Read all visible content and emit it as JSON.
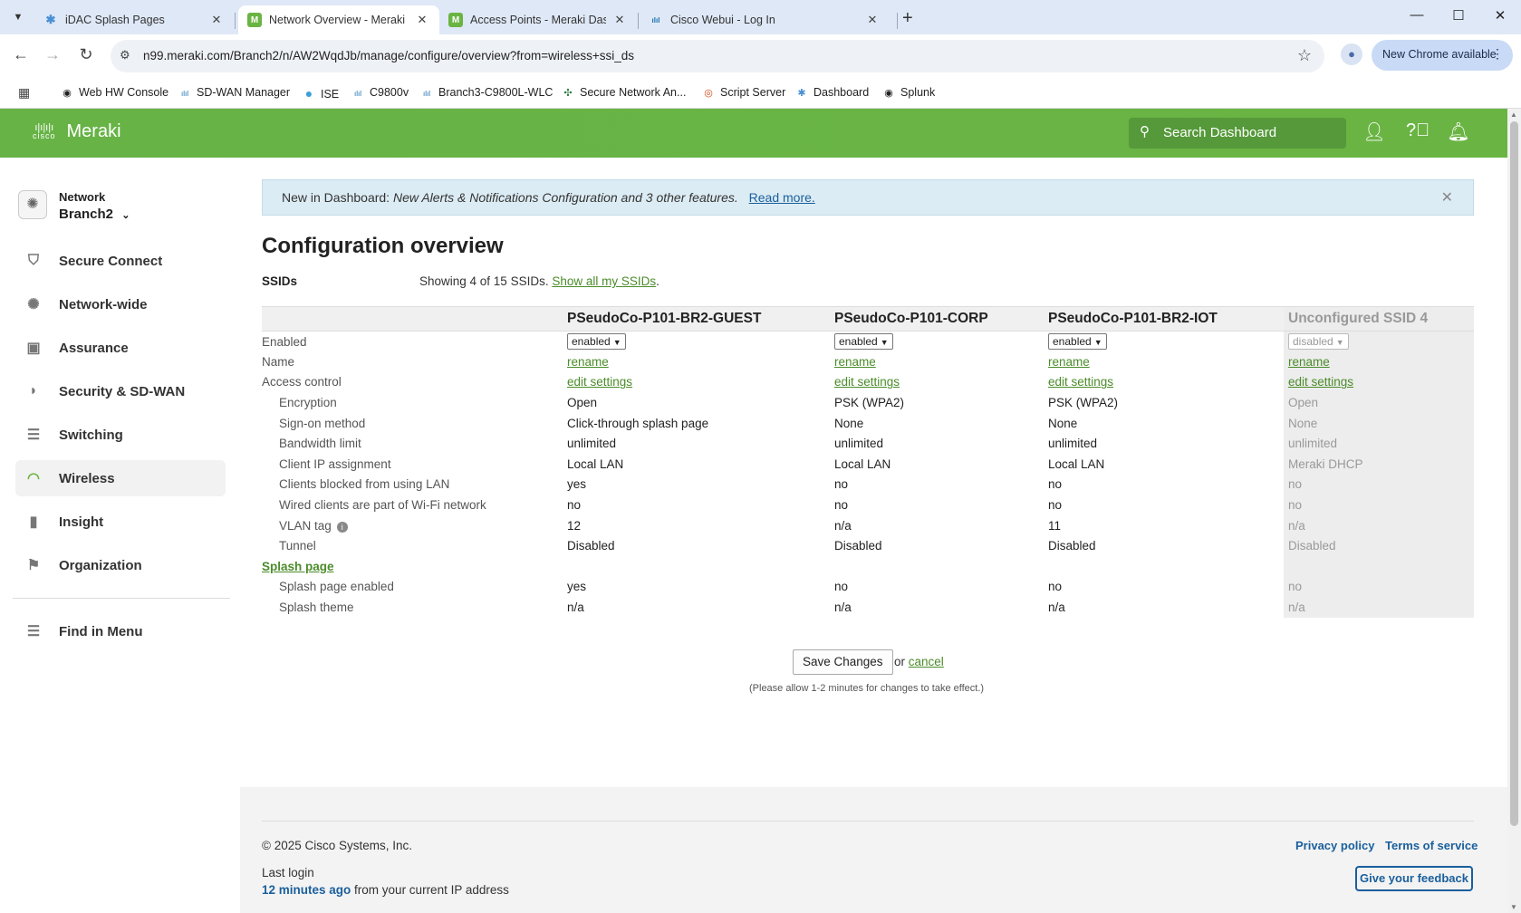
{
  "browser": {
    "tabs": [
      {
        "title": "iDAC Splash Pages",
        "favicon": "idac-icon",
        "active": false
      },
      {
        "title": "Network Overview - Meraki Dash",
        "favicon": "meraki-icon",
        "active": true
      },
      {
        "title": "Access Points - Meraki Dashboa",
        "favicon": "meraki-icon",
        "active": false
      },
      {
        "title": "Cisco Webui - Log In",
        "favicon": "cisco-icon",
        "active": false
      }
    ],
    "url": "n99.meraki.com/Branch2/n/AW2WqdJb/manage/configure/overview?from=wireless+ssi_ds",
    "new_chrome_label": "New Chrome available",
    "bookmarks": [
      {
        "label": "Web HW Console",
        "icon": "globe-icon"
      },
      {
        "label": "SD-WAN Manager",
        "icon": "cisco-icon"
      },
      {
        "label": "ISE",
        "icon": "circle-icon"
      },
      {
        "label": "C9800v",
        "icon": "cisco-icon"
      },
      {
        "label": "Branch3-C9800L-WLC",
        "icon": "cisco-icon"
      },
      {
        "label": "Secure Network An...",
        "icon": "network-icon"
      },
      {
        "label": "Script Server",
        "icon": "script-icon"
      },
      {
        "label": "Dashboard",
        "icon": "dashboard-icon"
      },
      {
        "label": "Splunk",
        "icon": "globe-icon"
      }
    ]
  },
  "header": {
    "brand_mark": "cisco",
    "brand": "Meraki",
    "search_placeholder": "Search Dashboard"
  },
  "sidebar": {
    "network_label": "Network",
    "network_name": "Branch2",
    "items": [
      {
        "label": "Secure Connect",
        "icon": "shield-cloud-icon",
        "active": false
      },
      {
        "label": "Network-wide",
        "icon": "gear-network-icon",
        "active": false
      },
      {
        "label": "Assurance",
        "icon": "assurance-icon",
        "active": false
      },
      {
        "label": "Security & SD-WAN",
        "icon": "shield-icon",
        "active": false
      },
      {
        "label": "Switching",
        "icon": "switch-icon",
        "active": false
      },
      {
        "label": "Wireless",
        "icon": "wifi-icon",
        "active": true
      },
      {
        "label": "Insight",
        "icon": "bar-chart-icon",
        "active": false
      },
      {
        "label": "Organization",
        "icon": "organization-icon",
        "active": false
      }
    ],
    "find_in_menu": "Find in Menu"
  },
  "banner": {
    "prefix": "New in Dashboard:",
    "feature": "New Alerts & Notifications Configuration",
    "suffix": "and 3 other features.",
    "link": "Read more."
  },
  "page": {
    "title": "Configuration overview",
    "ssids_label": "SSIDs",
    "ssids_count_text": "Showing 4 of 15 SSIDs.",
    "show_all_link": "Show all my SSIDs"
  },
  "table": {
    "columns": [
      "PSeudoCo-P101-BR2-GUEST",
      "PSeudoCo-P101-CORP",
      "PSeudoCo-P101-BR2-IOT",
      "Unconfigured SSID 4"
    ],
    "enabled_label": "Enabled",
    "enabled_values": [
      "enabled",
      "enabled",
      "enabled",
      "disabled"
    ],
    "name_label": "Name",
    "rename_link": "rename",
    "access_control_label": "Access control",
    "edit_settings_link": "edit settings",
    "rows": [
      {
        "label": "Encryption",
        "values": [
          "Open",
          "PSK (WPA2)",
          "PSK (WPA2)",
          "Open"
        ]
      },
      {
        "label": "Sign-on method",
        "values": [
          "Click-through splash page",
          "None",
          "None",
          "None"
        ]
      },
      {
        "label": "Bandwidth limit",
        "values": [
          "unlimited",
          "unlimited",
          "unlimited",
          "unlimited"
        ]
      },
      {
        "label": "Client IP assignment",
        "values": [
          "Local LAN",
          "Local LAN",
          "Local LAN",
          "Meraki DHCP"
        ]
      },
      {
        "label": "Clients blocked from using LAN",
        "values": [
          "yes",
          "no",
          "no",
          "no"
        ]
      },
      {
        "label": "Wired clients are part of Wi-Fi network",
        "values": [
          "no",
          "no",
          "no",
          "no"
        ]
      },
      {
        "label": "VLAN tag",
        "values": [
          "12",
          "n/a",
          "11",
          "n/a"
        ]
      },
      {
        "label": "Tunnel",
        "values": [
          "Disabled",
          "Disabled",
          "Disabled",
          "Disabled"
        ]
      }
    ],
    "splash_section": "Splash page",
    "splash_rows": [
      {
        "label": "Splash page enabled",
        "values": [
          "yes",
          "no",
          "no",
          "no"
        ]
      },
      {
        "label": "Splash theme",
        "values": [
          "n/a",
          "n/a",
          "n/a",
          "n/a"
        ]
      }
    ]
  },
  "actions": {
    "save": "Save Changes",
    "or": "or",
    "cancel": "cancel",
    "note": "(Please allow 1-2 minutes for changes to take effect.)"
  },
  "footer": {
    "copyright": "© 2025 Cisco Systems, Inc.",
    "privacy": "Privacy policy",
    "terms": "Terms of service",
    "last_login": "Last login",
    "login_ago": "12 minutes ago",
    "login_from": "from your current IP address",
    "feedback": "Give your feedback"
  },
  "colors": {
    "meraki_green": "#6ab443",
    "link_green": "#4b8c2a",
    "link_blue": "#1a5f9c",
    "banner_bg": "#dcecf4"
  }
}
